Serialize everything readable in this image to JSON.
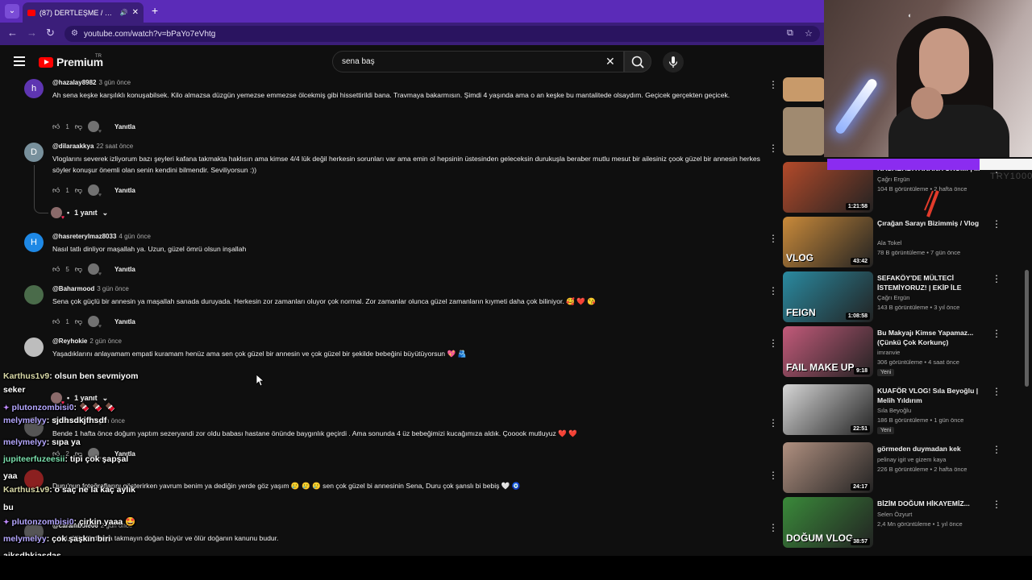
{
  "browser": {
    "tab_title": "(87) DERTLEŞME / VLOG - Y",
    "tab_close": "✕",
    "new_tab": "+",
    "url": "youtube.com/watch?v=bPaYo7eVhtg"
  },
  "yt": {
    "logo": "Premium",
    "logo_region": "TR",
    "search_query": "sena baş"
  },
  "reply_label": "Yanıtla",
  "comments": [
    {
      "user": "@hazalay8982",
      "time": "3 gün önce",
      "avatar_letter": "h",
      "avatar_color": "#5e35b1",
      "text": "Ah sena keşke karşılıklı konuşabilsek. Kilo almazsa düzgün yemezse emmezse ölcekmiş gibi hissettirildi bana. Travmaya bakarmısın. Şimdi 4 yaşında ama o an keşke bu mantalitede olsaydım. Geçicek gerçekten geçicek.",
      "likes": "1"
    },
    {
      "user": "@dilaraakkya",
      "time": "22 saat önce",
      "avatar_letter": "D",
      "avatar_color": "#78909c",
      "text": "Vloglarını severek izliyorum  bazı şeyleri kafana takmakta haklısın ama  kimse 4/4 lük değil herkesin sorunları var ama emin ol hepsinin üstesinden geleceksin  durukuşla beraber mutlu mesut bir ailesiniz  çook güzel bir annesin herkes söyler konuşur önemli olan senin kendini bilmendir. Seviliyorsun :))",
      "likes": "1",
      "replies": "1 yanıt"
    },
    {
      "user": "@hasreterylmaz8033",
      "time": "4 gün önce",
      "avatar_letter": "H",
      "avatar_color": "#1e88e5",
      "text": "Nasıl tatlı dinliyor maşallah ya. Uzun, güzel ömrü olsun inşallah",
      "likes": "5"
    },
    {
      "user": "@Baharmood",
      "time": "3 gün önce",
      "avatar_letter": "",
      "avatar_color": "#4a6b4a",
      "text": "Sena çok güçlü bir annesin ya maşallah sanada duruyada. Herkesin zor zamanları oluyor çok normal. Zor zamanlar olunca güzel zamanların kıymeti daha çok biliniyor. 🥰 ❤️ 😘",
      "likes": "1"
    },
    {
      "user": "@Reyhokie",
      "time": "2 gün önce",
      "avatar_letter": "",
      "avatar_color": "#bdbdbd",
      "text": "Yaşadıklarını anlayamam empati kuramam henüz ama sen çok güzel bir annesin ve çok güzel bir şekilde bebeğini büyütüyorsun 💖 🫂",
      "replies": "1 yanıt"
    },
    {
      "user": "@...me-0-0-0",
      "time": "3 gün önce",
      "avatar_letter": "",
      "avatar_color": "#555",
      "text": "Bende 1 hafta önce doğum yaptım sezeryandi zor oldu babası hastane önünde baygınlık geçirdi . Ama sonunda 4 üz bebeğimizi kucağımıza aldık. Çooook mutluyuz ❤️ ❤️",
      "likes": "2"
    },
    {
      "user": "",
      "time": "",
      "avatar_letter": "",
      "avatar_color": "#8b2020",
      "text": "Duru'nun fotoğraflarını gösterirken yavrum benim ya dediğin yerde göz yaşım 🥲 🥲 🥲  sen çok güzel bi annesinin Sena, Duru çok şanslı bi bebiş 🤍 🧿"
    },
    {
      "user": "@caramboIe06",
      "time": "2 gün önce",
      "avatar_letter": "",
      "avatar_color": "#555",
      "text": "...leri, ölümlü dünya takmayın doğan büyür ve ölür doğanın kanunu budur."
    }
  ],
  "recommendations": [
    {
      "title": "KASABADA ARANIYORUM! | ...",
      "channel": "Çağrı Ergün",
      "views": "104 B görüntüleme",
      "age": "2 hafta önce",
      "duration": "1:21:58",
      "thumb_color": "#b34a2a"
    },
    {
      "title": "Çırağan Sarayı Bizimmiş / Vlog",
      "channel": "Ala Tokel",
      "views": "78 B görüntüleme",
      "age": "7 gün önce",
      "duration": "43:42",
      "thumb_color": "#c98a3a",
      "thumb_text": "VLOG"
    },
    {
      "title": "SEFAKÖY'DE MÜLTECİ İSTEMİYORUZ! | EKİP İLE FEIG...",
      "channel": "Çağrı Ergün",
      "views": "143 B görüntüleme",
      "age": "3 yıl önce",
      "duration": "1:08:58",
      "thumb_color": "#2a8aa0",
      "thumb_text": "FEIGN"
    },
    {
      "title": "Bu Makyajı Kimse Yapamaz... (Çünkü Çok Korkunç)",
      "channel": "imranvie",
      "views": "306 görüntüleme",
      "age": "4 saat önce",
      "duration": "9:18",
      "thumb_color": "#c25a7a",
      "badge": "Yeni",
      "thumb_text": "FAIL MAKE UP"
    },
    {
      "title": "KUAFÖR VLOG! Sıla Beyoğlu | Melih Yıldırım",
      "channel": "Sıla Beyoğlu",
      "views": "186 B görüntüleme",
      "age": "1 gün önce",
      "duration": "22:51",
      "thumb_color": "#d6d6d6",
      "badge": "Yeni"
    },
    {
      "title": "görmeden duymadan kek",
      "channel": "pelinay igit  ve gizem kaya",
      "views": "226 B görüntüleme",
      "age": "2 hafta önce",
      "duration": "24:17",
      "thumb_color": "#b09080"
    },
    {
      "title": "BİZİM DOĞUM HİKAYEMİZ...",
      "channel": "Selen Özyurt",
      "views": "2,4 Mn görüntüleme",
      "age": "1 yıl önce",
      "duration": "38:57",
      "thumb_color": "#3a8a3a",
      "thumb_text": "DOĞUM VLOG"
    }
  ],
  "chat": [
    {
      "user": "Karthus1v9",
      "msg": ": olsun ben sevmiyom",
      "cls": "y"
    },
    {
      "user": "",
      "msg": "seker",
      "cls": ""
    },
    {
      "user": "plutonzombisi0",
      "msg": ": 🍫 🍫 🍫",
      "cls": "",
      "star": true
    },
    {
      "user": "melymelyy",
      "msg": ": sjdhsdkjfhsdf",
      "cls": ""
    },
    {
      "user": "melymelyy",
      "msg": ": sıpa ya",
      "cls": ""
    },
    {
      "user": "jupiteerfuzeesii",
      "msg": ": tipi çok şapşal",
      "cls": "g"
    },
    {
      "user": "",
      "msg": "yaa",
      "cls": ""
    },
    {
      "user": "Karthus1v9",
      "msg": ": o saç ne la kaç aylık",
      "cls": "y"
    },
    {
      "user": "",
      "msg": "bu",
      "cls": ""
    },
    {
      "user": "plutonzombisi0",
      "msg": ": çirkin yaaa 🤩",
      "cls": "",
      "star": true
    },
    {
      "user": "melymelyy",
      "msg": ": çok şaşkın biri",
      "cls": ""
    },
    {
      "user": "",
      "msg": "ajksdhkjasdas",
      "cls": ""
    }
  ],
  "stream": {
    "overlay": "TRY1000"
  }
}
